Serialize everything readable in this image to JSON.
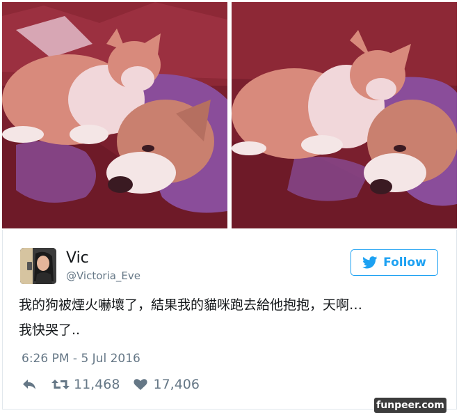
{
  "photos": [
    {
      "icon": "cat-and-dog-photo-1"
    },
    {
      "icon": "cat-and-dog-photo-2"
    }
  ],
  "tweet": {
    "display_name": "Vic",
    "handle": "@Victoria_Eve",
    "follow_label": "Follow",
    "text_lines": [
      "我的狗被煙火嚇壞了，結果我的貓咪跑去給他抱抱，天啊…",
      "我快哭了.."
    ],
    "timestamp": "6:26 PM - 5 Jul 2016",
    "retweet_count": "11,468",
    "like_count": "17,406"
  },
  "watermark": "funpeer.com",
  "colors": {
    "accent": "#1da1f2",
    "muted": "#657786",
    "text": "#14171a"
  }
}
